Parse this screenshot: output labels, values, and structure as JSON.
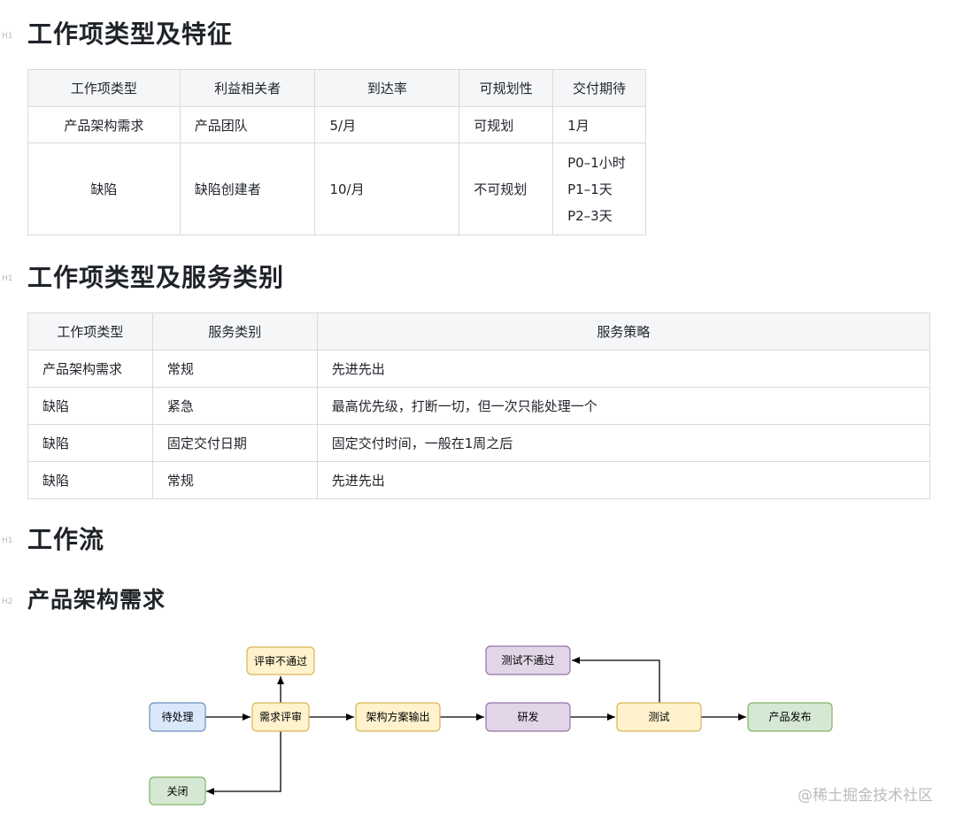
{
  "sections": {
    "s1": {
      "heading": "工作项类型及特征",
      "level": "H1"
    },
    "s2": {
      "heading": "工作项类型及服务类别",
      "level": "H1"
    },
    "s3": {
      "heading": "工作流",
      "level": "H1"
    },
    "s4": {
      "heading": "产品架构需求",
      "level": "H2"
    }
  },
  "table1": {
    "headers": [
      "工作项类型",
      "利益相关者",
      "到达率",
      "可规划性",
      "交付期待"
    ],
    "rows": [
      [
        "产品架构需求",
        "产品团队",
        "5/月",
        "可规划",
        "1月"
      ],
      [
        "缺陷",
        "缺陷创建者",
        "10/月",
        "不可规划",
        [
          "P0–1小时",
          "P1–1天",
          "P2–3天"
        ]
      ]
    ]
  },
  "table2": {
    "headers": [
      "工作项类型",
      "服务类别",
      "服务策略"
    ],
    "rows": [
      [
        "产品架构需求",
        "常规",
        "先进先出"
      ],
      [
        "缺陷",
        "紧急",
        "最高优先级，打断一切，但一次只能处理一个"
      ],
      [
        "缺陷",
        "固定交付日期",
        "固定交付时间，一般在1周之后"
      ],
      [
        "缺陷",
        "常规",
        "先进先出"
      ]
    ]
  },
  "flow": {
    "nodes": {
      "pending": "待处理",
      "review": "需求评审",
      "review_fail": "评审不通过",
      "close": "关闭",
      "arch_output": "架构方案输出",
      "develop": "研发",
      "test": "测试",
      "test_fail": "测试不通过",
      "release": "产品发布"
    },
    "colors": {
      "blue_fill": "#dae8fc",
      "blue_stroke": "#6c8ebf",
      "yellow_fill": "#fff2cc",
      "yellow_stroke": "#d6b656",
      "green_fill": "#d5e8d4",
      "green_stroke": "#82b366",
      "purple_fill": "#e1d5e7",
      "purple_stroke": "#9673a6"
    }
  },
  "watermark": "@稀土掘金技术社区"
}
